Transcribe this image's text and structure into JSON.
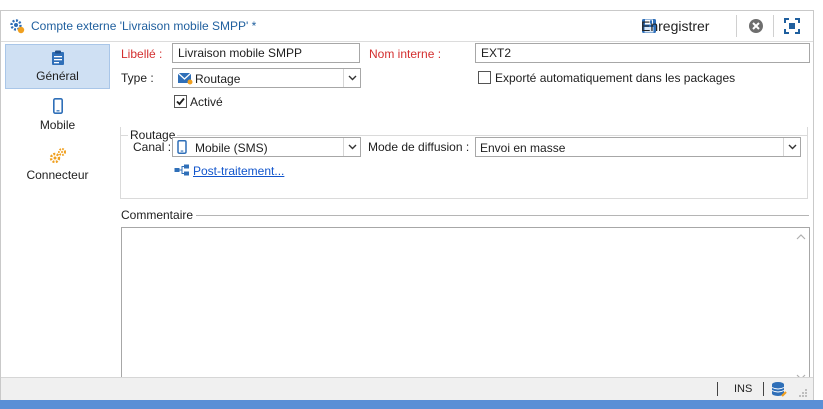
{
  "window": {
    "title": "Compte externe 'Livraison mobile SMPP' *"
  },
  "toolbar": {
    "save_label": "Enregistrer"
  },
  "sidebar": {
    "items": [
      {
        "label": "Général",
        "icon": "clipboard-icon",
        "active": true
      },
      {
        "label": "Mobile",
        "icon": "mobile-phone-icon",
        "active": false
      },
      {
        "label": "Connecteur",
        "icon": "gears-icon",
        "active": false
      }
    ]
  },
  "form": {
    "label_caption": "Libellé :",
    "label_value": "Livraison mobile SMPP",
    "internal_name_caption": "Nom interne :",
    "internal_name_value": "EXT2",
    "type_caption": "Type :",
    "type_value": "Routage",
    "exported_caption": "Exporté automatiquement dans les packages",
    "exported_checked": false,
    "active_caption": "Activé",
    "active_checked": true
  },
  "routing": {
    "group_title": "Routage",
    "channel_caption": "Canal :",
    "channel_value": "Mobile (SMS)",
    "mode_caption": "Mode de diffusion :",
    "mode_value": "Envoi en masse",
    "post_processing_link": "Post-traitement..."
  },
  "comment": {
    "title": "Commentaire",
    "value": ""
  },
  "statusbar": {
    "mode": "INS"
  },
  "colors": {
    "accent_blue": "#1f5f9e",
    "required_red": "#d32f2f",
    "active_nav_bg": "#cfe0f3",
    "window_edge": "#5a8fd6"
  }
}
